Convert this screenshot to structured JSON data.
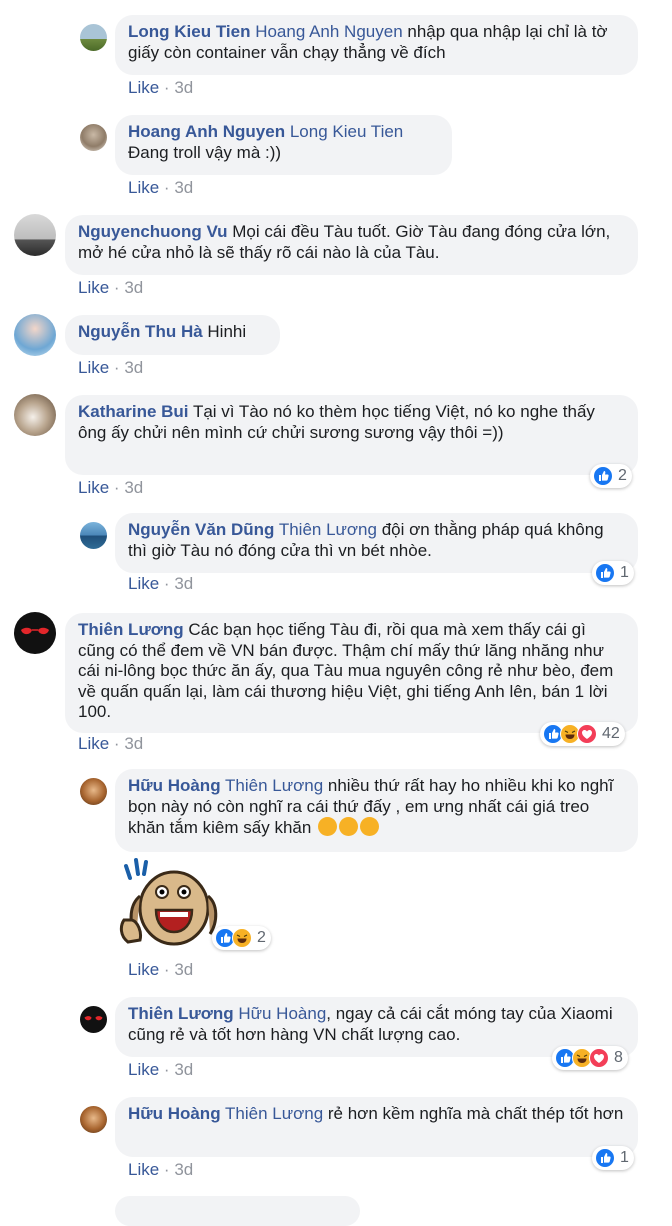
{
  "like_label": "Like",
  "dot": "·",
  "colors": {
    "name": "#385898",
    "bubble": "#f2f3f5",
    "meta": "#90949c",
    "like": "#1877f2",
    "haha": "#f7b125",
    "love": "#f33e58"
  },
  "comments": [
    {
      "name": "Long Kieu Tien",
      "tag": "Hoang Anh Nguyen",
      "text": " nhập qua nhập lại chỉ là tờ giấy còn container vẫn chạy thẳng về đích",
      "time": "3d"
    },
    {
      "name": "Hoang Anh Nguyen",
      "tag": "Long Kieu Tien",
      "text": "Đang troll vậy mà :))",
      "time": "3d"
    },
    {
      "name": "Nguyenchuong Vu",
      "text": "Mọi cái đều Tàu tuốt. Giờ Tàu đang đóng cửa lớn, mở hé cửa nhỏ là sẽ thấy rõ cái nào là của Tàu.",
      "time": "3d"
    },
    {
      "name": "Nguyễn Thu Hà",
      "text": "Hinhi",
      "time": "3d"
    },
    {
      "name": "Katharine Bui",
      "text": "Tại vì Tào nó ko thèm học tiếng Việt, nó ko nghe thấy ông ấy chửi nên mình cứ chửi sương sương vậy thôi =))",
      "time": "3d",
      "react_count": "2"
    },
    {
      "name": "Nguyễn Văn Dũng",
      "tag": "Thiên Lương",
      "text": " đội ơn thằng pháp quá không thì giờ Tàu nó đóng cửa thì vn bét nhòe.",
      "time": "3d",
      "react_count": "1"
    },
    {
      "name": "Thiên Lương",
      "text": "Các bạn học tiếng Tàu đi, rồi qua mà xem thấy cái gì cũng có thể đem về VN bán được. Thậm chí mấy thứ lăng nhăng như cái ni-lông bọc thức ăn ấy, qua Tàu mua nguyên công rẻ như bèo, đem về quấn quấn lại, làm cái thương hiệu Việt, ghi tiếng Anh lên, bán 1 lời 100.",
      "time": "3d",
      "react_count": "42"
    },
    {
      "name": "Hữu Hoàng",
      "tag": "Thiên Lương",
      "text": " nhiều thứ rất hay ho nhiều khi ko nghĩ bọn này nó còn nghĩ ra cái thứ đấy , em ưng nhất cái giá treo khăn tắm kiêm sấy khăn",
      "time": "3d",
      "react_count": "2"
    },
    {
      "name": "Thiên Lương",
      "tag": "Hữu Hoàng",
      "text": ", ngay cả cái cắt móng tay của Xiaomi cũng rẻ và tốt hơn hàng VN chất lượng cao.",
      "time": "3d",
      "react_count": "8"
    },
    {
      "name": "Hữu Hoàng",
      "tag": "Thiên Lương",
      "text": " rẻ hơn kềm nghĩa mà chất thép tốt hơn",
      "time": "3d",
      "react_count": "1"
    }
  ]
}
